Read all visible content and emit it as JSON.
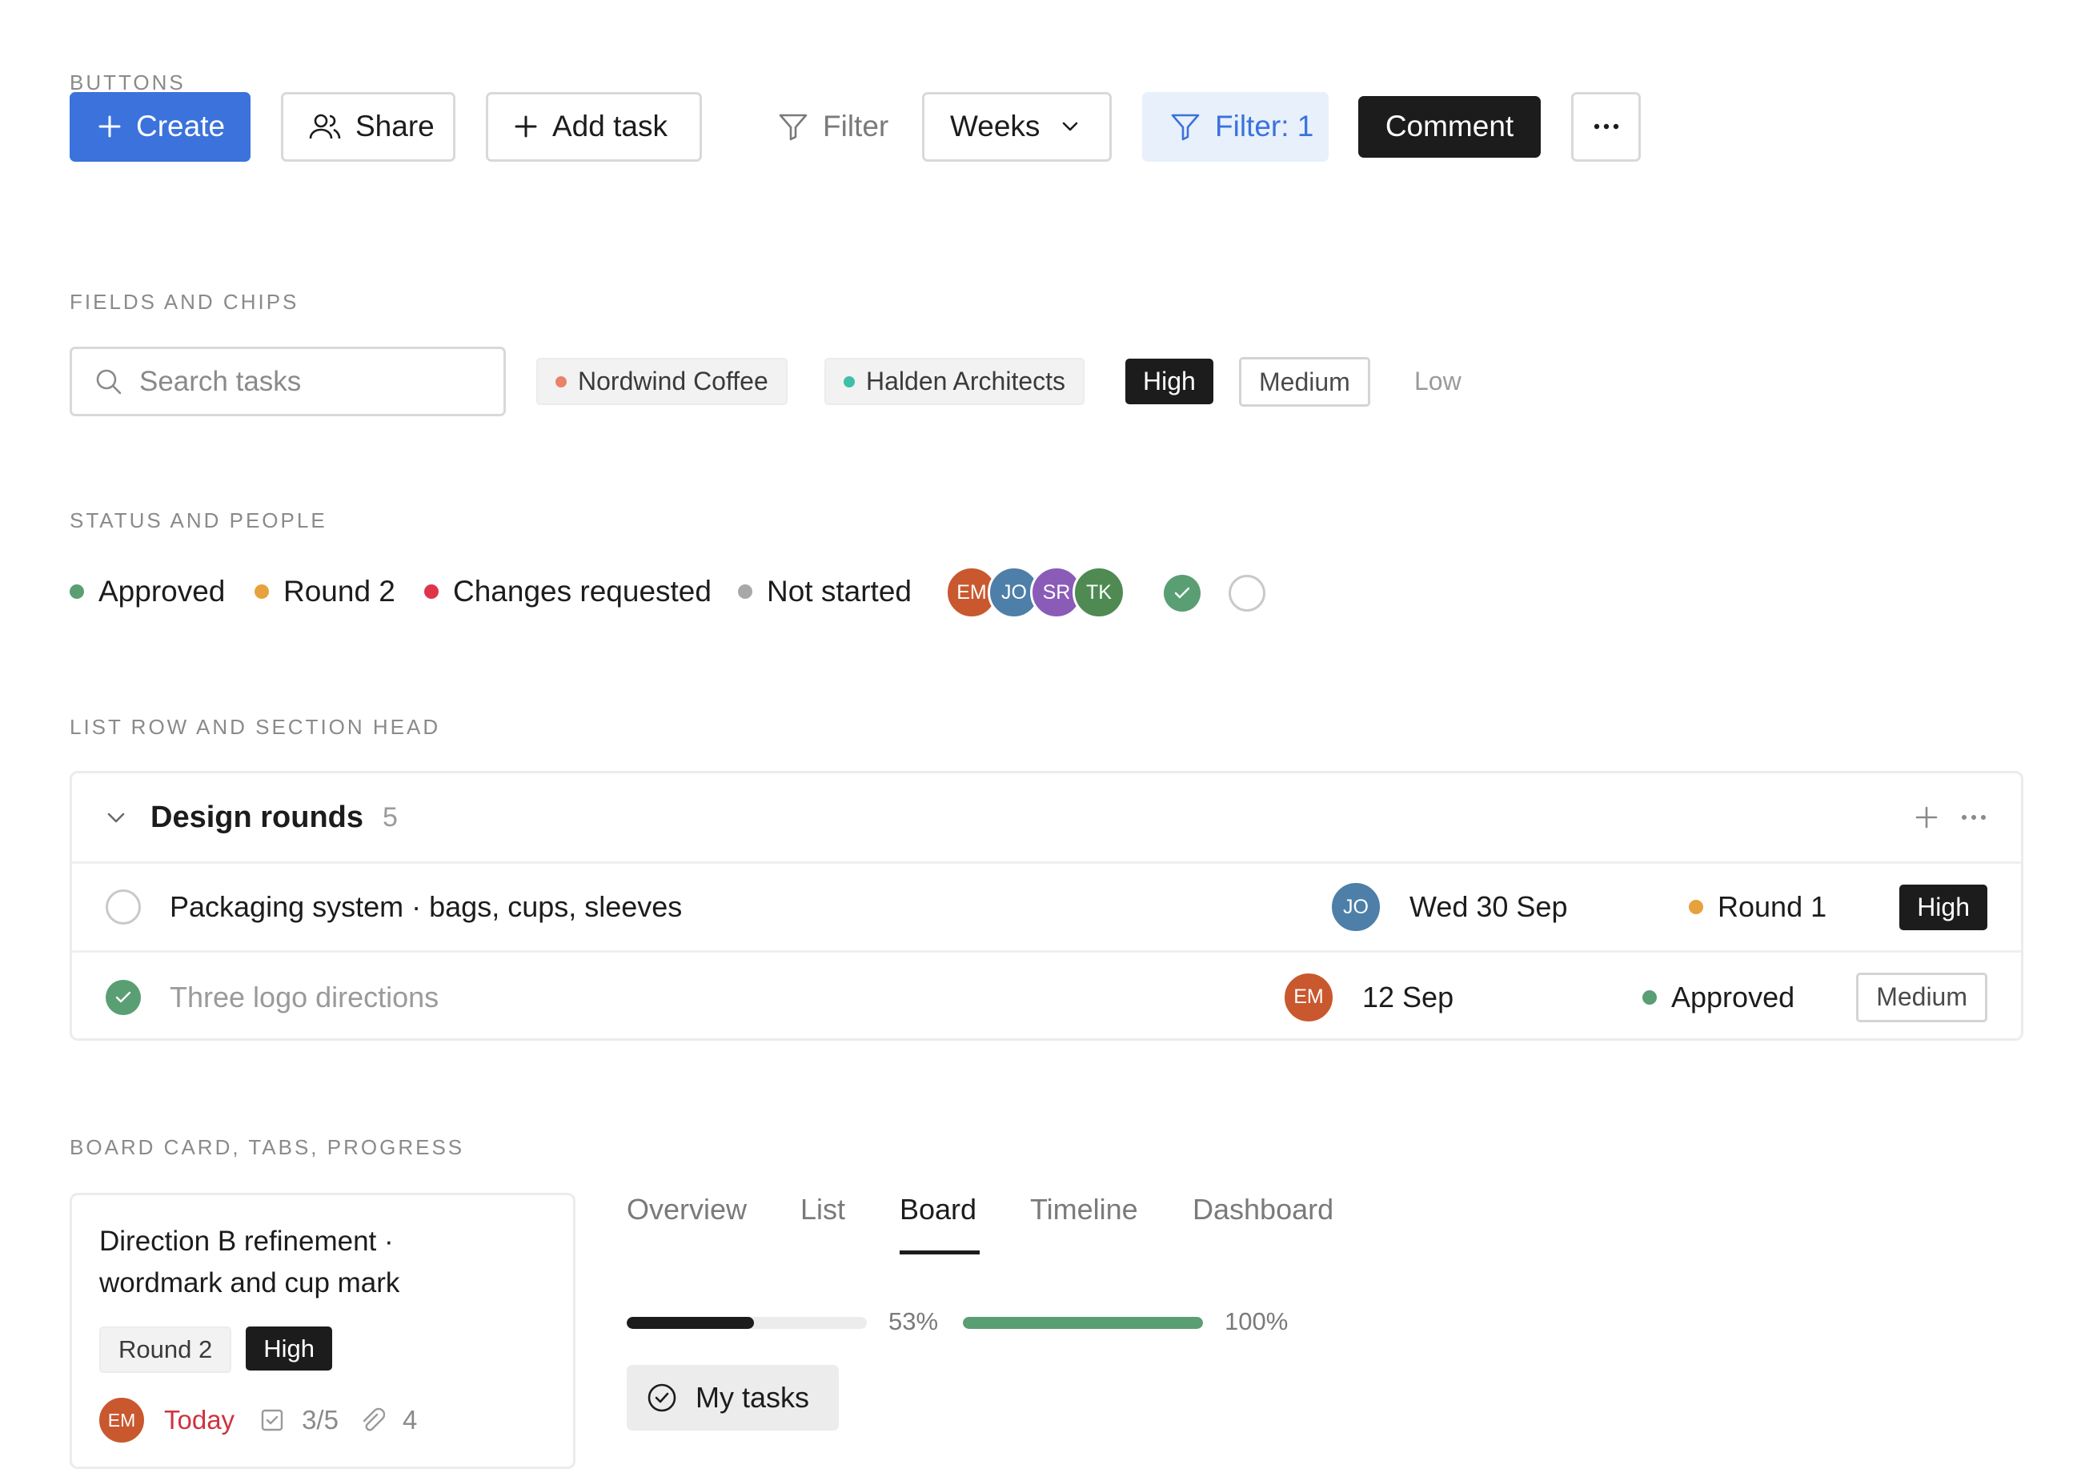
{
  "sections": {
    "buttons": "BUTTONS",
    "fields": "FIELDS AND CHIPS",
    "status": "STATUS AND PEOPLE",
    "list": "LIST ROW AND SECTION HEAD",
    "board": "BOARD CARD, TABS, PROGRESS"
  },
  "buttons": {
    "create": "Create",
    "share": "Share",
    "add_task": "Add task",
    "filter": "Filter",
    "weeks": "Weeks",
    "filter_active": "Filter: 1",
    "comment": "Comment"
  },
  "search": {
    "placeholder": "Search tasks"
  },
  "chips": {
    "client1": {
      "label": "Nordwind Coffee",
      "color": "#e8826a"
    },
    "client2": {
      "label": "Halden Architects",
      "color": "#3fbfa8"
    },
    "high": "High",
    "medium": "Medium",
    "low": "Low"
  },
  "statuses": [
    {
      "label": "Approved",
      "color": "#5a9e74"
    },
    {
      "label": "Round 2",
      "color": "#e6a23c"
    },
    {
      "label": "Changes requested",
      "color": "#e0344a"
    },
    {
      "label": "Not started",
      "color": "#a8a8a8"
    }
  ],
  "people": [
    {
      "initials": "EM",
      "color": "#c9582e"
    },
    {
      "initials": "JO",
      "color": "#4d7fa8"
    },
    {
      "initials": "SR",
      "color": "#8a5cb8"
    },
    {
      "initials": "TK",
      "color": "#4e8a52"
    }
  ],
  "list": {
    "section_title": "Design rounds",
    "section_count": "5",
    "rows": [
      {
        "title": "Packaging system · bags, cups, sleeves",
        "assignee": "JO",
        "assignee_color": "#4d7fa8",
        "date": "Wed 30 Sep",
        "status": "Round 1",
        "status_color": "#e6a23c",
        "priority": "High",
        "done": false
      },
      {
        "title": "Three logo directions",
        "assignee": "EM",
        "assignee_color": "#c9582e",
        "date": "12 Sep",
        "status": "Approved",
        "status_color": "#5a9e74",
        "priority": "Medium",
        "done": true
      }
    ]
  },
  "card": {
    "title": "Direction B refinement · wordmark and cup mark",
    "round": "Round 2",
    "priority": "High",
    "assignee": "EM",
    "due": "Today",
    "subtasks": "3/5",
    "attachments": "4"
  },
  "tabs": [
    "Overview",
    "List",
    "Board",
    "Timeline",
    "Dashboard"
  ],
  "active_tab": "Board",
  "progress": [
    {
      "value": 0.53,
      "label": "53%",
      "color": "#1c1c1c"
    },
    {
      "value": 1.0,
      "label": "100%",
      "color": "#5a9e74"
    }
  ],
  "my_tasks": "My tasks"
}
